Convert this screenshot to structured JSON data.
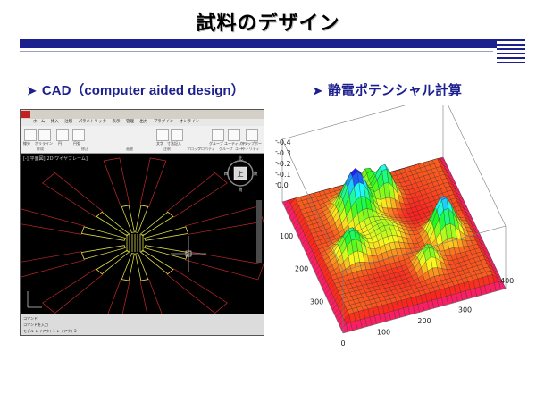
{
  "slide": {
    "title": "試料のデザイン",
    "bullets": [
      {
        "marker": "➤",
        "text": "CAD（computer aided design）"
      },
      {
        "marker": "➤",
        "text": "静電ポテンシャル計算"
      }
    ]
  },
  "cad": {
    "menu_items": [
      "ホーム",
      "挿入",
      "注釈",
      "パラメトリック",
      "表示",
      "管理",
      "出力",
      "プラグイン",
      "オンライン"
    ],
    "ribbon_labels": [
      "線分",
      "ポリライン",
      "円",
      "円弧",
      "文字",
      "寸法記入",
      "グループ",
      "ユーティリティ",
      "クリップボード"
    ],
    "group_labels": [
      "作成",
      "修正",
      "画層",
      "注釈",
      "ブロック",
      "プロパティ",
      "グループ",
      "ユーティリティ"
    ],
    "view_tab": "[-][平面図][2D ワイヤフレーム]",
    "viewcube_label": "上",
    "viewcube_dirs": {
      "north": "北",
      "south": "南",
      "west": "西",
      "east": "東"
    },
    "command_line": "コマンド:",
    "command_prompt": "コマンドを入力",
    "model_tabs": [
      "モデル",
      "レイアウト1",
      "レイアウト2"
    ],
    "colors": {
      "background": "#000000",
      "pattern": "#d8d84a",
      "frame": "#c0282c"
    }
  },
  "plot": {
    "z_ticks": [
      "-0.4",
      "-0.3",
      "-0.2",
      "-0.1",
      "0.0"
    ],
    "y_ticks": [
      "100",
      "200",
      "300"
    ],
    "x_ticks_front": [
      "0",
      "100",
      "200",
      "300"
    ],
    "x_ticks_right": [
      "400"
    ],
    "colormap": "hue (red-magenta-blue-cyan-green-yellow)"
  }
}
